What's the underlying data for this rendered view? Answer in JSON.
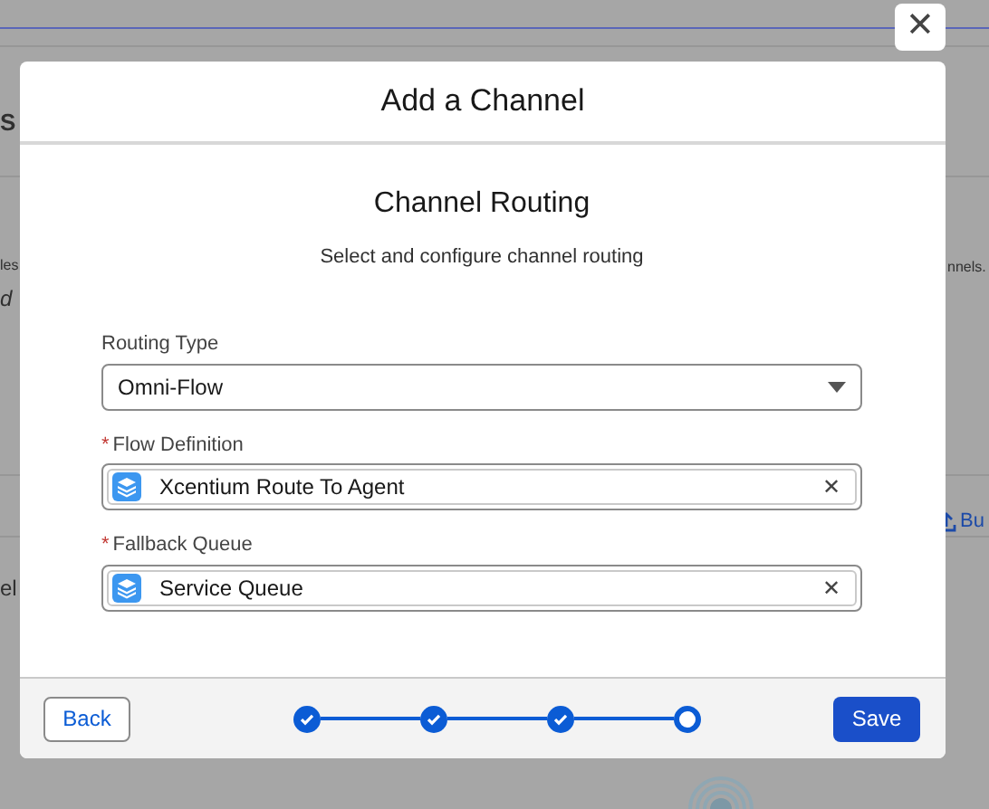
{
  "background_page": {
    "fragments": [
      {
        "text": "S",
        "kind": "heading"
      },
      {
        "text": "les",
        "kind": "text"
      },
      {
        "text": "nnels.",
        "kind": "text"
      },
      {
        "text": "d",
        "kind": "italic"
      },
      {
        "text": "Bu",
        "kind": "button"
      },
      {
        "text": "el",
        "kind": "text"
      }
    ]
  },
  "modal": {
    "close_label": "✕",
    "title": "Add a Channel",
    "heading": "Channel Routing",
    "subtitle": "Select and configure channel routing",
    "fields": [
      {
        "kind": "select",
        "label": "Routing Type",
        "required": false,
        "value": "Omni-Flow"
      },
      {
        "kind": "lookup",
        "label": "Flow Definition",
        "required": true,
        "value": "Xcentium Route To Agent",
        "clear_label": "✕"
      },
      {
        "kind": "lookup",
        "label": "Fallback Queue",
        "required": true,
        "value": "Service Queue",
        "clear_label": "✕"
      }
    ],
    "steps": [
      {
        "completed": true
      },
      {
        "completed": true
      },
      {
        "completed": true
      },
      {
        "completed": false
      }
    ],
    "required_mark": "*",
    "back_button": "Back",
    "save_button": "Save"
  }
}
